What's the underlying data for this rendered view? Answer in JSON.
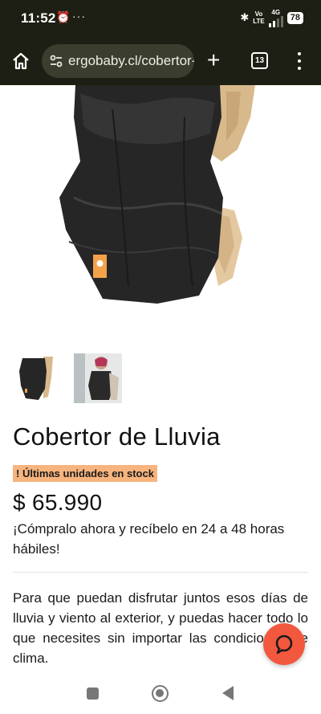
{
  "status_bar": {
    "time": "11:52",
    "alarm_icon": "alarm-clock-icon",
    "more_dots": "···",
    "network_top": "Vo",
    "network_bottom": "LTE",
    "network_type": "4G",
    "battery": "78"
  },
  "browser": {
    "url": "ergobaby.cl/cobertor-de-lluvia",
    "tab_count": "13",
    "icons": [
      "home-icon",
      "site-settings-icon",
      "new-tab-icon",
      "tab-switcher-icon",
      "overflow-menu-icon"
    ]
  },
  "product": {
    "title": "Cobertor de Lluvia",
    "stock_badge": "! Últimas unidades en stock",
    "price": "$ 65.990",
    "shipping": "¡Cómpralo ahora y recíbelo en 24 a 48 horas hábiles!",
    "description": "Para que puedan disfrutar juntos esos días de lluvia y viento al exterior, y puedas hacer todo lo que necesites sin importar las condiciones de clima."
  },
  "colors": {
    "browser_bar": "#1d1f14",
    "url_pill": "#3b3e2e",
    "badge": "#f7b47e",
    "chat_button": "#f2583e"
  },
  "chat": {
    "icon": "chat-bubble-icon"
  },
  "nav": {
    "icons": [
      "recent-apps-icon",
      "home-circle-icon",
      "back-icon"
    ]
  }
}
